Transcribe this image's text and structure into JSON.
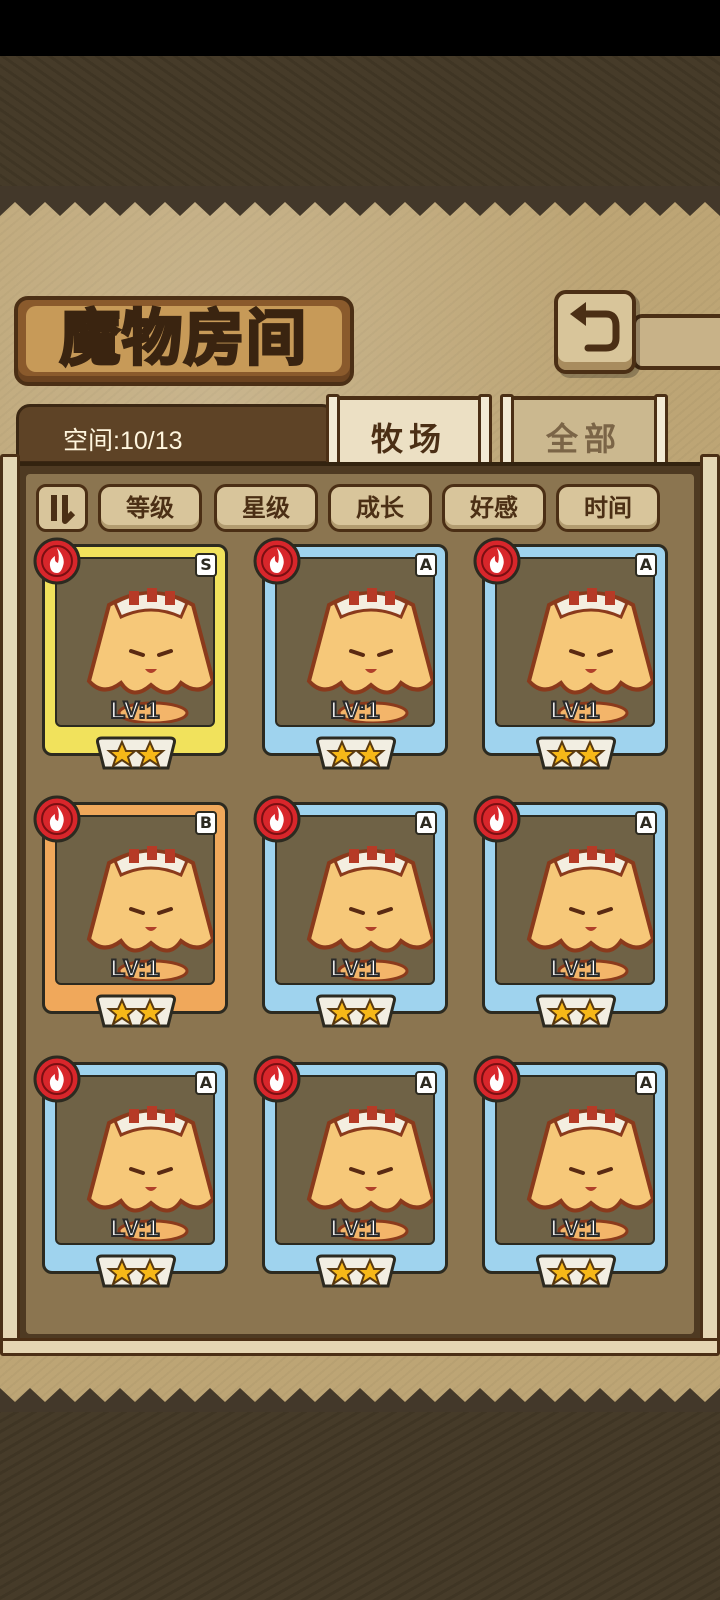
{
  "title": "魔物房间",
  "capacity": "空间:10/13",
  "tabs": [
    {
      "label": "牧场",
      "active": true
    },
    {
      "label": "全部",
      "active": false
    }
  ],
  "sort_buttons": [
    "等级",
    "星级",
    "成长",
    "好感",
    "时间"
  ],
  "cards": [
    {
      "rank": "S",
      "level": "LV:1",
      "stars": 2,
      "element": "fire-icon"
    },
    {
      "rank": "A",
      "level": "LV:1",
      "stars": 2,
      "element": "fire-icon"
    },
    {
      "rank": "A",
      "level": "LV:1",
      "stars": 2,
      "element": "fire-icon"
    },
    {
      "rank": "B",
      "level": "LV:1",
      "stars": 2,
      "element": "fire-icon"
    },
    {
      "rank": "A",
      "level": "LV:1",
      "stars": 2,
      "element": "fire-icon"
    },
    {
      "rank": "A",
      "level": "LV:1",
      "stars": 2,
      "element": "fire-icon"
    },
    {
      "rank": "A",
      "level": "LV:1",
      "stars": 2,
      "element": "fire-icon"
    },
    {
      "rank": "A",
      "level": "LV:1",
      "stars": 2,
      "element": "fire-icon"
    },
    {
      "rank": "A",
      "level": "LV:1",
      "stars": 2,
      "element": "fire-icon"
    }
  ],
  "colors": {
    "rank_S": "#f1e25c",
    "rank_A": "#9fd3ee",
    "rank_B": "#f0a85b",
    "fire": "#d8262b"
  }
}
